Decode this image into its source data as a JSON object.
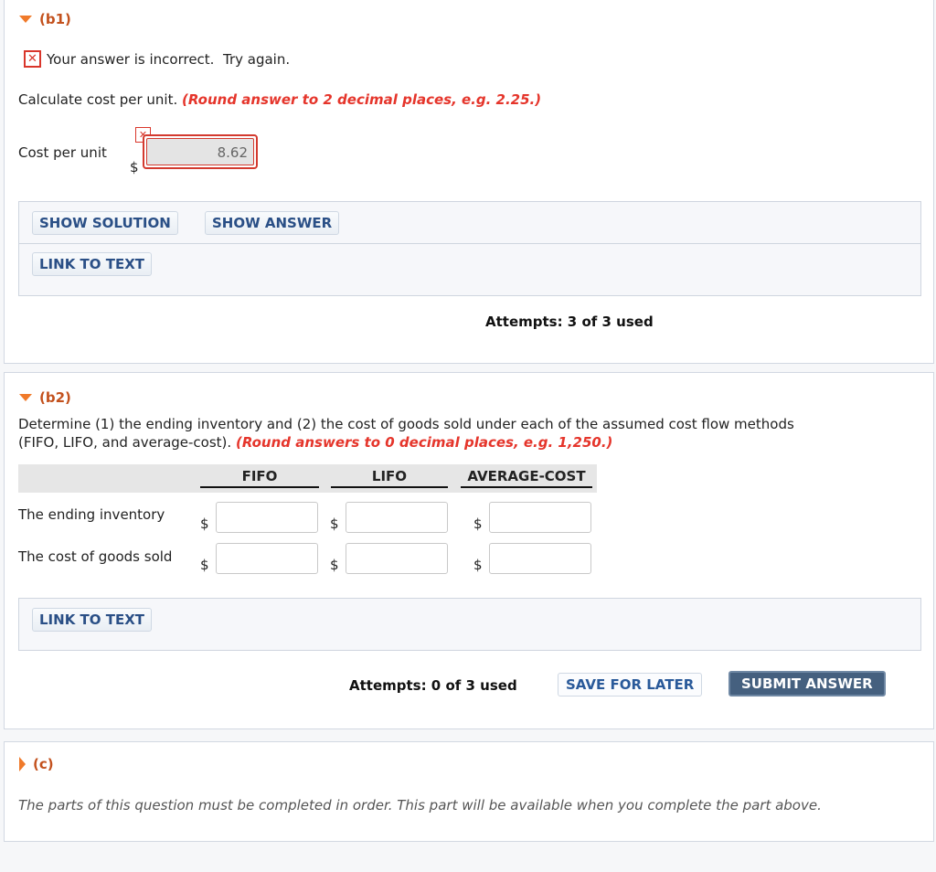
{
  "colors": {
    "accent_orange": "#f07a2a",
    "part_label": "#c3511d",
    "hint_red": "#e5352b",
    "error_red": "#d33a2f",
    "button_text": "#2a4f86",
    "submit_bg": "#45607f"
  },
  "part_b1": {
    "label": "(b1)",
    "feedback": "Your answer is incorrect.  Try again.",
    "instruction": "Calculate cost per unit.",
    "hint": "(Round answer to 2 decimal places, e.g. 2.25.)",
    "field_label": "Cost per unit",
    "currency": "$",
    "field_value": "8.62",
    "buttons": {
      "show_solution": "SHOW SOLUTION",
      "show_answer": "SHOW ANSWER",
      "link_to_text": "LINK TO TEXT"
    },
    "attempts": "Attempts: 3 of 3 used"
  },
  "part_b2": {
    "label": "(b2)",
    "instruction_line1": "Determine (1) the ending inventory and (2) the cost of goods sold under each of the assumed cost flow methods",
    "instruction_line2": "(FIFO, LIFO, and average-cost).",
    "hint": "(Round answers to 0 decimal places, e.g. 1,250.)",
    "columns": [
      "FIFO",
      "LIFO",
      "AVERAGE-COST"
    ],
    "rows": [
      {
        "label": "The ending inventory",
        "values": [
          "",
          "",
          ""
        ]
      },
      {
        "label": "The cost of goods sold",
        "values": [
          "",
          "",
          ""
        ]
      }
    ],
    "currency": "$",
    "buttons": {
      "link_to_text": "LINK TO TEXT",
      "save_for_later": "SAVE FOR LATER",
      "submit_answer": "SUBMIT ANSWER"
    },
    "attempts": "Attempts: 0 of 3 used"
  },
  "part_c": {
    "label": "(c)",
    "note": "The parts of this question must be completed in order. This part will be available when you complete the part above."
  }
}
